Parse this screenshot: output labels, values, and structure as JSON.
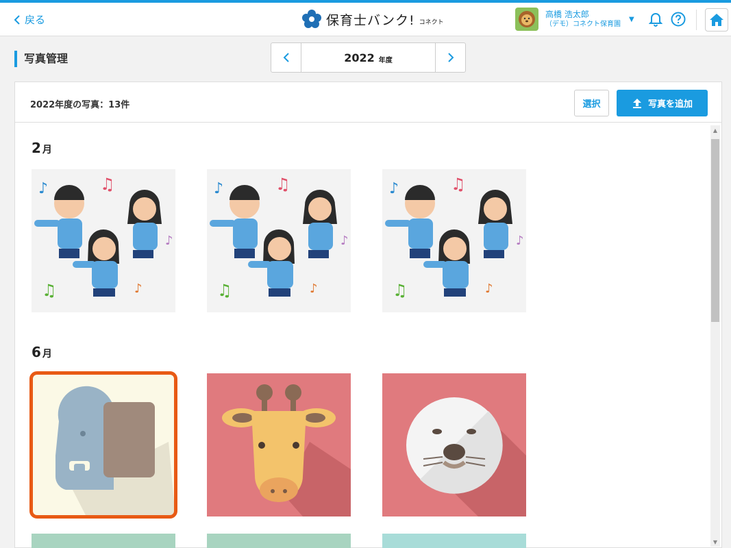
{
  "header": {
    "back_label": "戻る",
    "logo_text": "保育士バンク!",
    "logo_sub": "コネクト",
    "user_name": "高橋 浩太郎",
    "user_org": "（デモ）コネクト保育園"
  },
  "page": {
    "title": "写真管理",
    "year": "2022",
    "year_unit": "年度"
  },
  "panel": {
    "count_text": "2022年度の写真：13件",
    "select_label": "選択",
    "add_label": "写真を追加"
  },
  "months": [
    {
      "num": "2",
      "unit": "月"
    },
    {
      "num": "6",
      "unit": "月"
    }
  ],
  "colors": {
    "accent": "#1a9be0",
    "selected_outline": "#e85a14",
    "animal_bg": "#e07a7e"
  },
  "icons": [
    "chevron-left-icon",
    "logo-flower-icon",
    "bell-icon",
    "help-icon",
    "home-icon",
    "upload-icon"
  ]
}
